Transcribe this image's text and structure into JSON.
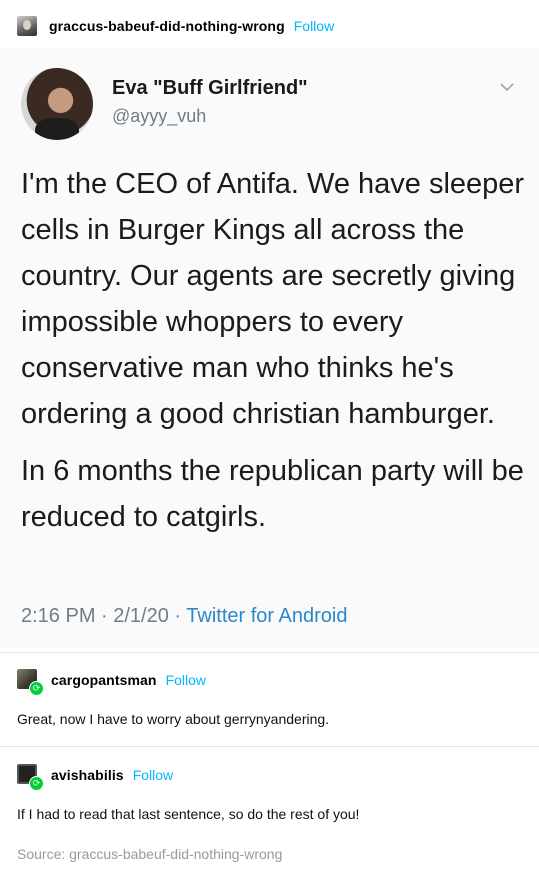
{
  "post": {
    "author": "graccus-babeuf-did-nothing-wrong",
    "follow_label": "Follow"
  },
  "tweet": {
    "display_name": "Eva \"Buff Girlfriend\"",
    "handle": "@ayyy_vuh",
    "paragraphs": [
      "I'm the CEO of Antifa. We have sleeper cells in Burger Kings all across the country. Our agents are secretly giving impossible whoppers to every conservative man who thinks he's ordering a good christian hamburger.",
      "In 6 months the republican party will be reduced to catgirls."
    ],
    "meta_time": "2:16 PM · 2/1/20 · ",
    "meta_source": "Twitter for Android"
  },
  "reblogs": [
    {
      "username": "cargopantsman",
      "follow_label": "Follow",
      "text": "Great, now I have to worry about gerrynyandering."
    },
    {
      "username": "avishabilis",
      "follow_label": "Follow",
      "text": "If I had to read that last sentence, so do the rest of you!"
    }
  ],
  "source": "Source: graccus-babeuf-did-nothing-wrong",
  "colors": {
    "follow": "#00b8ff",
    "reblog_badge": "#00cf35",
    "twitter_link": "#2b87c9",
    "muted": "#6f7d87"
  }
}
